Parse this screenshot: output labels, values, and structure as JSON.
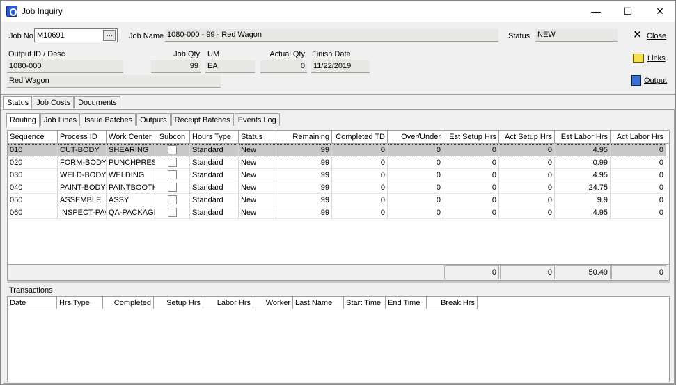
{
  "window": {
    "title": "Job Inquiry",
    "minimize": "—",
    "maximize": "☐",
    "close": "✕"
  },
  "header": {
    "job_no_label": "Job No",
    "job_no": "M10691",
    "ellipsis": "...",
    "job_name_label": "Job Name",
    "job_name": "1080-000 - 99 - Red Wagon",
    "status_label": "Status",
    "status": "NEW",
    "output_label": "Output ID / Desc",
    "output_id": "1080-000",
    "output_desc": "Red Wagon",
    "job_qty_label": "Job Qty",
    "job_qty": "99",
    "um_label": "UM",
    "um": "EA",
    "actual_qty_label": "Actual Qty",
    "actual_qty": "0",
    "finish_date_label": "Finish Date",
    "finish_date": "11/22/2019"
  },
  "actions": {
    "close": "Close",
    "links": "Links",
    "output": "Output"
  },
  "tabs": [
    "Status",
    "Job Costs",
    "Documents"
  ],
  "subtabs": [
    "Routing",
    "Job Lines",
    "Issue Batches",
    "Outputs",
    "Receipt Batches",
    "Events Log"
  ],
  "routing": {
    "columns": [
      "Sequence",
      "Process ID",
      "Work Center",
      "Subcon",
      "Hours Type",
      "Status",
      "Remaining",
      "Completed TD",
      "Over/Under",
      "Est Setup Hrs",
      "Act Setup Hrs",
      "Est Labor Hrs",
      "Act Labor Hrs"
    ],
    "rows": [
      [
        "010",
        "CUT-BODY",
        "SHEARING",
        "",
        "Standard",
        "New",
        "99",
        "0",
        "0",
        "0",
        "0",
        "4.95",
        "0"
      ],
      [
        "020",
        "FORM-BODY",
        "PUNCHPRESS",
        "",
        "Standard",
        "New",
        "99",
        "0",
        "0",
        "0",
        "0",
        "0.99",
        "0"
      ],
      [
        "030",
        "WELD-BODY",
        "WELDING",
        "",
        "Standard",
        "New",
        "99",
        "0",
        "0",
        "0",
        "0",
        "4.95",
        "0"
      ],
      [
        "040",
        "PAINT-BODY",
        "PAINTBOOTH",
        "",
        "Standard",
        "New",
        "99",
        "0",
        "0",
        "0",
        "0",
        "24.75",
        "0"
      ],
      [
        "050",
        "ASSEMBLE",
        "ASSY",
        "",
        "Standard",
        "New",
        "99",
        "0",
        "0",
        "0",
        "0",
        "9.9",
        "0"
      ],
      [
        "060",
        "INSPECT-PAC",
        "QA-PACKAGI",
        "",
        "Standard",
        "New",
        "99",
        "0",
        "0",
        "0",
        "0",
        "4.95",
        "0"
      ]
    ],
    "totals": [
      "0",
      "0",
      "50.49",
      "0"
    ]
  },
  "transactions": {
    "label": "Transactions",
    "columns": [
      "Date",
      "Hrs Type",
      "Completed",
      "Setup Hrs",
      "Labor Hrs",
      "Worker",
      "Last Name",
      "Start Time",
      "End Time",
      "Break Hrs"
    ]
  }
}
